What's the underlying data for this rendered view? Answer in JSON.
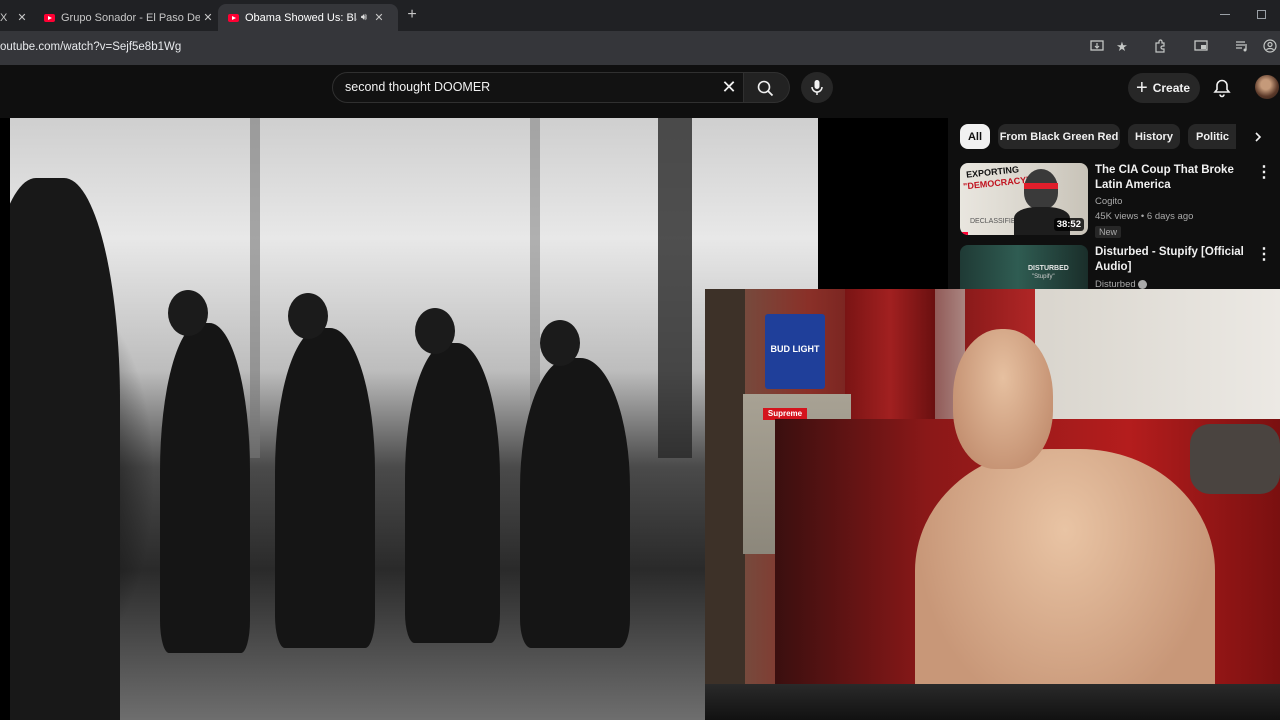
{
  "browser": {
    "tabs": [
      {
        "title": "Grupo Sonador - El Paso Del Gu",
        "active": false
      },
      {
        "title": "Obama Showed Us: Black C",
        "active": true
      }
    ],
    "left_tab_fragment": "X",
    "url": "outube.com/watch?v=Sejf5e8b1Wg",
    "new_tab": "+"
  },
  "youtube": {
    "search_value": "second thought DOOMER",
    "create_label": "Create",
    "chips": [
      "All",
      "From Black Green Red",
      "History",
      "Politic"
    ],
    "recommendations": [
      {
        "title": "The CIA Coup That Broke Latin America",
        "channel": "Cogito",
        "meta": "45K views • 6 days ago",
        "badge": "New",
        "duration": "38:52",
        "thumb_text_1": "EXPORTING",
        "thumb_text_2": "\"DEMOCRACY\"",
        "thumb_text_3": "DECLASSIFIED"
      },
      {
        "title": "Disturbed - Stupify [Official Audio]",
        "channel": "Disturbed",
        "thumb_text_1": "DISTURBED",
        "thumb_text_2": "\"Stupify\""
      }
    ]
  },
  "webcam_scene": {
    "can_text": "BUD LIGHT",
    "sticker_text": "Supreme"
  },
  "colors": {
    "yt_red": "#ff0033",
    "page_bg": "#0f0f0f",
    "chip_bg": "#272727"
  },
  "icons": [
    "close-icon",
    "search-icon",
    "mic-icon",
    "plus-icon",
    "bell-icon",
    "chevron-right-icon",
    "more-vert-icon",
    "bookmark-star-icon",
    "extensions-icon",
    "cast-icon",
    "profile-icon"
  ]
}
